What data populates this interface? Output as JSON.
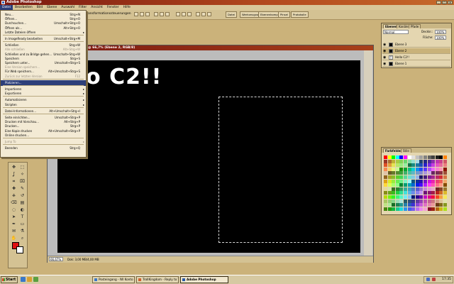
{
  "app": {
    "title": "Adobe Photoshop",
    "controls": [
      "_",
      "□",
      "×"
    ]
  },
  "menubar": [
    "Datei",
    "Bearbeiten",
    "Bild",
    "Ebene",
    "Auswahl",
    "Filter",
    "Ansicht",
    "Fenster",
    "Hilfe"
  ],
  "options_bar": {
    "label": "Transformationssteuerungen",
    "tabs": [
      "Datei",
      "Werkzeugvorg.",
      "Ebenenkomp.",
      "Pinsel",
      "Protokolle"
    ]
  },
  "file_menu": [
    {
      "label": "Neu...",
      "shortcut": "Strg+N"
    },
    {
      "label": "Öffnen...",
      "shortcut": "Strg+O"
    },
    {
      "label": "Durchsuchen...",
      "shortcut": "Umschalt+Strg+O"
    },
    {
      "label": "Öffnen als...",
      "shortcut": "Alt+Strg+O"
    },
    {
      "label": "Letzte Dateien öffnen",
      "shortcut": "",
      "submenu": true
    },
    {
      "sep": true
    },
    {
      "label": "In ImageReady bearbeiten",
      "shortcut": "Umschalt+Strg+M"
    },
    {
      "sep": true
    },
    {
      "label": "Schließen",
      "shortcut": "Strg+W"
    },
    {
      "label": "Alle schließen",
      "shortcut": "Alt+Strg+W",
      "disabled": true
    },
    {
      "label": "Schließen und zu Bridge gehen...",
      "shortcut": "Umschalt+Strg+W"
    },
    {
      "label": "Speichern",
      "shortcut": "Strg+S"
    },
    {
      "label": "Speichern unter...",
      "shortcut": "Umschalt+Strg+S"
    },
    {
      "label": "Eine Version speichern...",
      "shortcut": "",
      "disabled": true
    },
    {
      "label": "Für Web speichern...",
      "shortcut": "Alt+Umschalt+Strg+S"
    },
    {
      "label": "Zurück zur letzten Version",
      "shortcut": "F12",
      "disabled": true
    },
    {
      "sep": true
    },
    {
      "label": "Platzieren...",
      "shortcut": "",
      "highlighted": true
    },
    {
      "sep": true
    },
    {
      "label": "Importieren",
      "shortcut": "",
      "submenu": true
    },
    {
      "label": "Exportieren",
      "shortcut": "",
      "submenu": true
    },
    {
      "sep": true
    },
    {
      "label": "Automatisieren",
      "shortcut": "",
      "submenu": true
    },
    {
      "label": "Skripten",
      "shortcut": "",
      "submenu": true
    },
    {
      "sep": true
    },
    {
      "label": "Datei-Informationen...",
      "shortcut": "Alt+Umschalt+Strg+I"
    },
    {
      "sep": true
    },
    {
      "label": "Seite einrichten...",
      "shortcut": "Umschalt+Strg+P"
    },
    {
      "label": "Drucken mit Vorschau...",
      "shortcut": "Alt+Strg+P"
    },
    {
      "label": "Drucken...",
      "shortcut": "Strg+P"
    },
    {
      "label": "Eine Kopie drucken",
      "shortcut": "Alt+Umschalt+Strg+P"
    },
    {
      "label": "Online drucken...",
      "shortcut": ""
    },
    {
      "sep": true
    },
    {
      "label": "Jump To",
      "shortcut": "",
      "submenu": true,
      "disabled": true
    },
    {
      "sep": true
    },
    {
      "label": "Beenden",
      "shortcut": "Strg+Q"
    }
  ],
  "document": {
    "title": "@ 66,7% (Ebene 2, RGB/8)",
    "text": "Hello C2!!",
    "zoom": "66,67%",
    "info": "Dok: 3,00 MB/4,00 MB"
  },
  "layers_panel": {
    "tabs": [
      "Ebenen",
      "Kanäle",
      "Pfade"
    ],
    "blend_mode": "Normal",
    "opacity_label": "Deckkr.:",
    "opacity": "100%",
    "fill_label": "Fläche:",
    "fill": "100%",
    "layers": [
      {
        "name": "Ebene 3",
        "type": "pixel",
        "selected": false
      },
      {
        "name": "Ebene 2",
        "type": "pixel",
        "selected": true
      },
      {
        "name": "Hello C2!!",
        "type": "text",
        "selected": false
      },
      {
        "name": "Ebene 1",
        "type": "pixel",
        "selected": false
      }
    ]
  },
  "swatches_panel": {
    "tabs": [
      "Farbfelder",
      "Stile"
    ]
  },
  "colors": {
    "foreground": "#e01010",
    "background": "#ffffff",
    "accent": "#2d3f7a"
  },
  "tools": [
    "move-icon",
    "marquee-icon",
    "lasso-icon",
    "wand-icon",
    "crop-icon",
    "slice-icon",
    "heal-icon",
    "brush-icon",
    "stamp-icon",
    "history-brush-icon",
    "eraser-icon",
    "gradient-icon",
    "blur-icon",
    "dodge-icon",
    "path-select-icon",
    "type-icon",
    "pen-icon",
    "shape-icon",
    "notes-icon",
    "eyedropper-icon",
    "hand-icon",
    "zoom-icon"
  ],
  "taskbar": {
    "start": "Start",
    "tasks": [
      {
        "label": "Posteingang - IW Konto - ...",
        "active": false
      },
      {
        "label": "TrollKingdom - Reply to T...",
        "active": false
      },
      {
        "label": "Adobe Photoshop",
        "active": true
      }
    ],
    "clock": "17:35"
  }
}
